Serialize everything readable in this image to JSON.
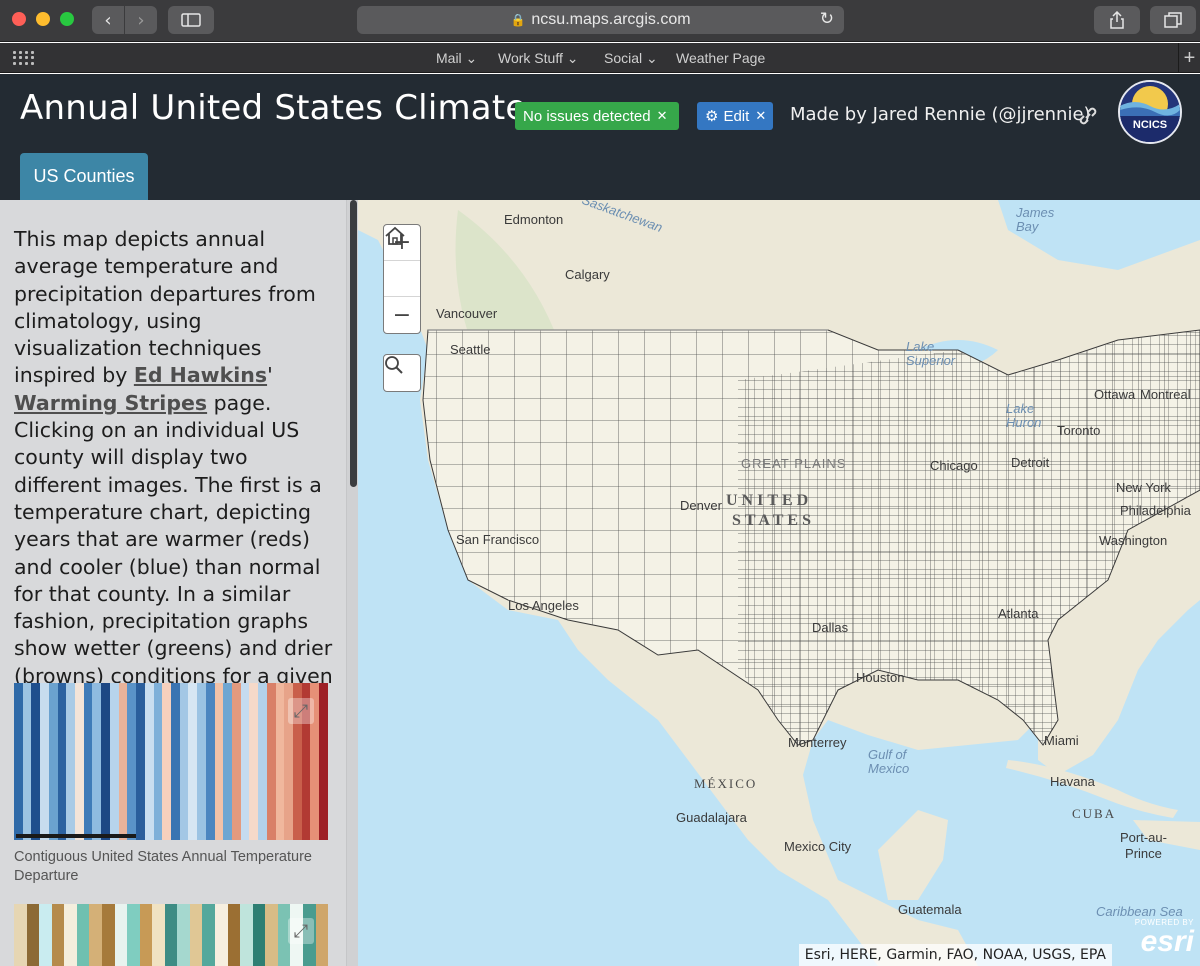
{
  "browser": {
    "url": "ncsu.maps.arcgis.com",
    "favorites": [
      "Mail",
      "Work Stuff",
      "Social",
      "Weather Page"
    ]
  },
  "app": {
    "title": "Annual United States Climate ...",
    "status_badge": "No issues detected",
    "edit_label": "Edit",
    "author": "Made by Jared Rennie (@jjrennie)",
    "logo_text": "NCICS",
    "tab_label": "US Counties"
  },
  "sidebar": {
    "description_before": "This map depicts annual average temperature and precipitation departures from climatology, using visualization techniques inspired by ",
    "link1": "Ed Hawkins",
    "description_mid": "' ",
    "link2": "Warming Stripes",
    "description_after": " page. Clicking on an individual US county will display two different images. The first is a temperature chart, depicting years that are warmer (reds) and cooler (blue) than normal for that county. In a similar fashion, precipitation graphs show wetter (greens) and drier (browns) conditions for a given year.",
    "image1_caption": "Contiguous United States Annual Temperature Departure"
  },
  "map": {
    "labels": {
      "edmonton": "Edmonton",
      "saskatchewan": "Saskatchewan",
      "calgary": "Calgary",
      "vancouver": "Vancouver",
      "seattle": "Seattle",
      "james_bay": "James\nBay",
      "lake_superior": "Lake\nSuperior",
      "ottawa": "Ottawa",
      "montreal": "Montreal",
      "lake_huron": "Lake\nHuron",
      "toronto": "Toronto",
      "great_plains": "GREAT PLAINS",
      "chicago": "Chicago",
      "detroit": "Detroit",
      "new_york": "New York",
      "united": "UNITED",
      "states": "STATES",
      "denver": "Denver",
      "philadelphia": "Philadelphia",
      "washington": "Washington",
      "san_francisco": "San Francisco",
      "los_angeles": "Los Angeles",
      "dallas": "Dallas",
      "atlanta": "Atlanta",
      "houston": "Houston",
      "monterrey": "Monterrey",
      "miami": "Miami",
      "gulf_of_mexico": "Gulf of\nMexico",
      "mexico": "MÉXICO",
      "havana": "Havana",
      "cuba": "CUBA",
      "guadalajara": "Guadalajara",
      "mexico_city": "Mexico City",
      "port_au_prince": "Port-au-\nPrince",
      "guatemala": "Guatemala",
      "caribbean_sea": "Caribbean Sea"
    },
    "attribution": "Esri, HERE, Garmin, FAO, NOAA, USGS, EPA",
    "esri_powered": "POWERED BY",
    "esri_name": "esri"
  },
  "colors": {
    "header_bg": "#232b33",
    "tab_bg": "#3d86a6",
    "badge_ok": "#36a74a",
    "badge_edit": "#3477c2",
    "sidebar_bg": "#d8d9db"
  }
}
